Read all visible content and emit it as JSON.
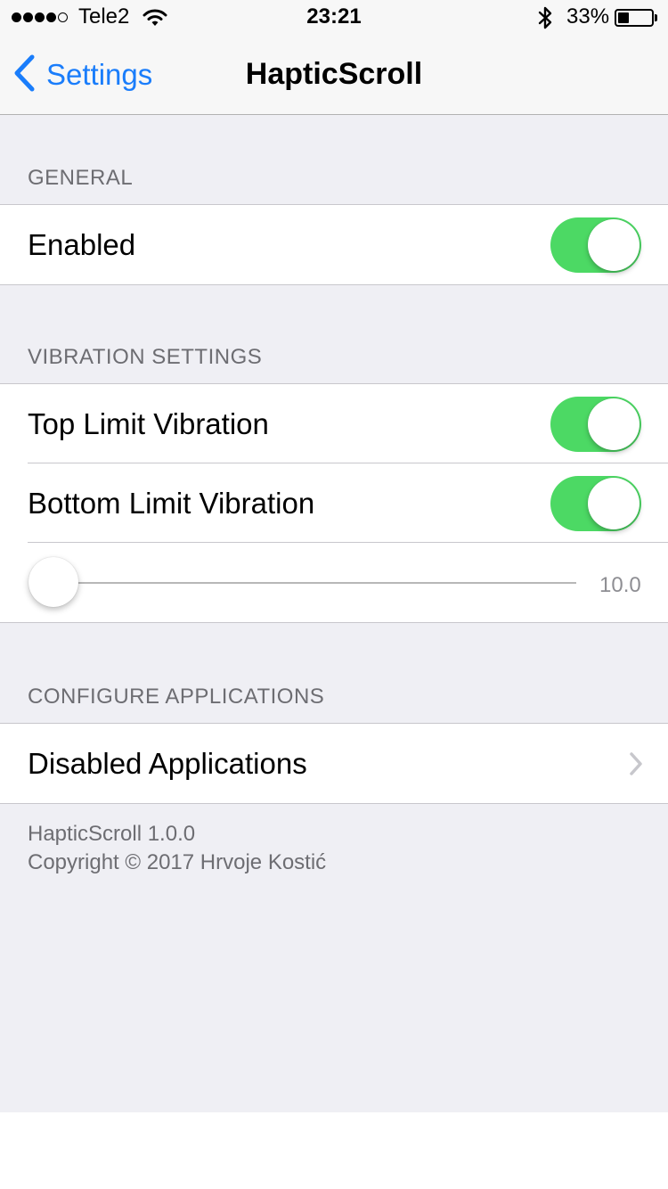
{
  "status_bar": {
    "carrier": "Tele2",
    "time": "23:21",
    "battery_percent_text": "33%",
    "battery_level": 0.33,
    "signal_filled_dots": 4,
    "signal_total_dots": 5
  },
  "nav": {
    "back_label": "Settings",
    "title": "HapticScroll"
  },
  "general": {
    "header": "GENERAL",
    "enabled_label": "Enabled",
    "enabled_on": true
  },
  "vibration": {
    "header": "VIBRATION SETTINGS",
    "top_limit_label": "Top Limit Vibration",
    "top_limit_on": true,
    "bottom_limit_label": "Bottom Limit Vibration",
    "bottom_limit_on": true,
    "slider_value_text": "10.0"
  },
  "configure": {
    "header": "CONFIGURE APPLICATIONS",
    "disabled_apps_label": "Disabled Applications"
  },
  "footer": {
    "version": "HapticScroll 1.0.0",
    "copyright": "Copyright © 2017 Hrvoje Kostić"
  },
  "colors": {
    "accent": "#1a7dfb",
    "switch_on": "#4cd964",
    "background": "#efeff4"
  },
  "icons": [
    "wifi-icon",
    "bluetooth-icon",
    "battery-icon",
    "back-chevron-icon",
    "disclosure-chevron-icon"
  ]
}
